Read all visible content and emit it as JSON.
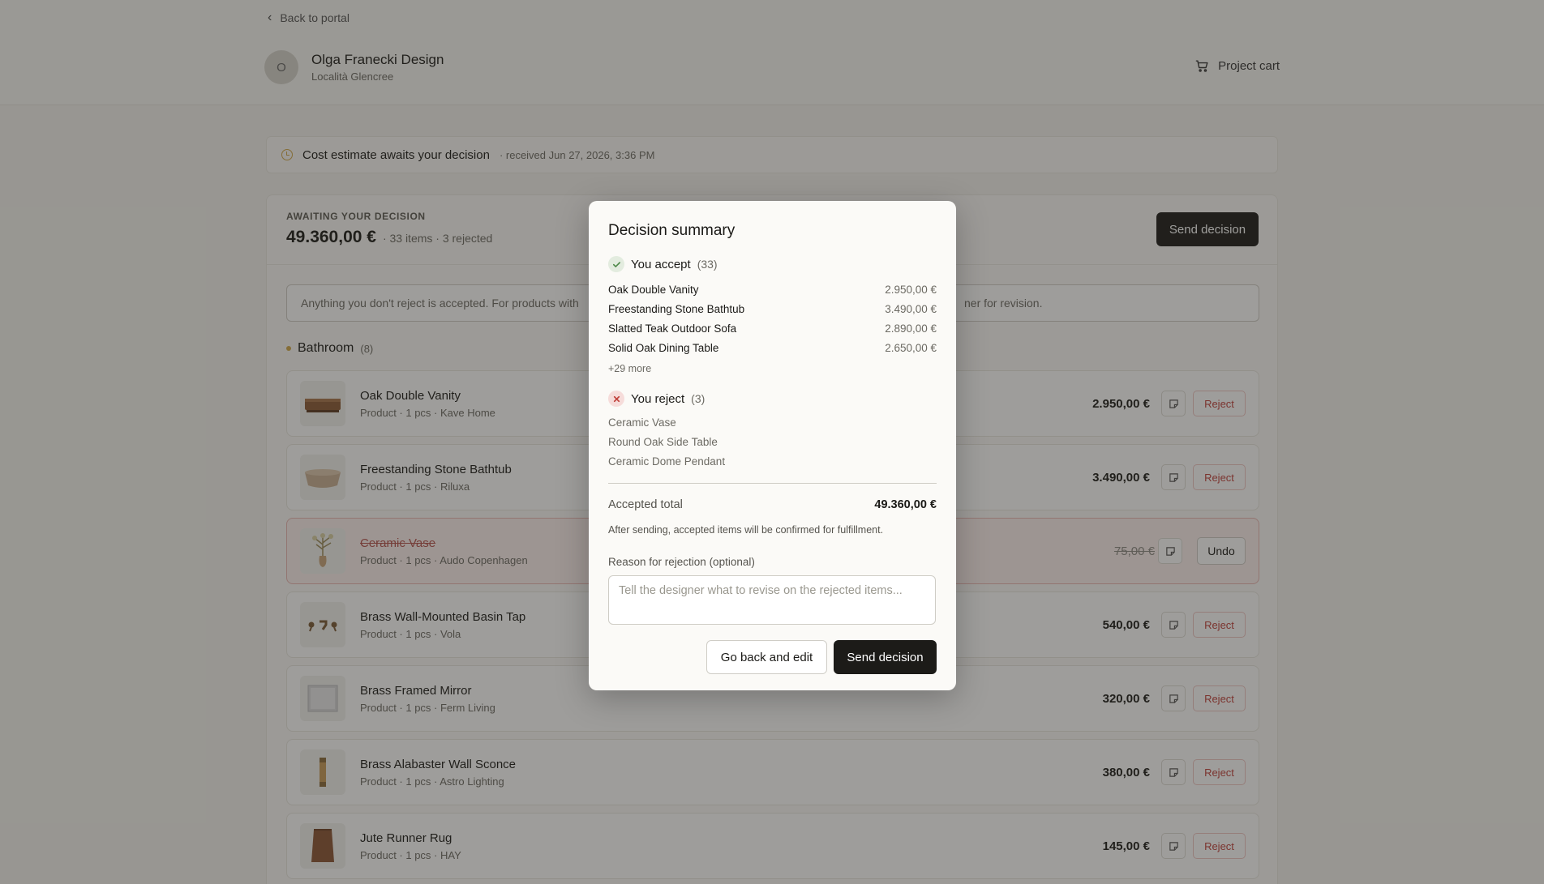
{
  "header": {
    "back_label": "Back to portal",
    "avatar_initial": "O",
    "studio_name": "Olga Franecki Design",
    "studio_location": "Località Glencree",
    "cart_label": "Project cart"
  },
  "notice": {
    "title": "Cost estimate awaits your decision",
    "meta": "· received Jun 27, 2026, 3:36 PM"
  },
  "summary_panel": {
    "eyebrow": "AWAITING YOUR DECISION",
    "total": "49.360,00 €",
    "meta": "· 33 items · 3 rejected",
    "send_label": "Send decision",
    "info_text": "Anything you don't reject is accepted. For products with",
    "info_tail": "ner for revision.",
    "section": {
      "name": "Bathroom",
      "count": "(8)"
    }
  },
  "items": [
    {
      "name": "Oak Double Vanity",
      "sub": "Product · 1 pcs · Kave Home",
      "price": "2.950,00 €",
      "action": "Reject",
      "rejected": false,
      "thumb": "vanity"
    },
    {
      "name": "Freestanding Stone Bathtub",
      "sub": "Product · 1 pcs · Riluxa",
      "price": "3.490,00 €",
      "action": "Reject",
      "rejected": false,
      "thumb": "bathtub"
    },
    {
      "name": "Ceramic Vase",
      "sub": "Product · 1 pcs · Audo Copenhagen",
      "price": "75,00 €",
      "action": "Undo",
      "rejected": true,
      "thumb": "vase"
    },
    {
      "name": "Brass Wall-Mounted Basin Tap",
      "sub": "Product · 1 pcs · Vola",
      "price": "540,00 €",
      "action": "Reject",
      "rejected": false,
      "thumb": "tap"
    },
    {
      "name": "Brass Framed Mirror",
      "sub": "Product · 1 pcs · Ferm Living",
      "price": "320,00 €",
      "action": "Reject",
      "rejected": false,
      "thumb": "mirror"
    },
    {
      "name": "Brass Alabaster Wall Sconce",
      "sub": "Product · 1 pcs · Astro Lighting",
      "price": "380,00 €",
      "action": "Reject",
      "rejected": false,
      "thumb": "sconce"
    },
    {
      "name": "Jute Runner Rug",
      "sub": "Product · 1 pcs · HAY",
      "price": "145,00 €",
      "action": "Reject",
      "rejected": false,
      "thumb": "rug"
    }
  ],
  "modal": {
    "title": "Decision summary",
    "accept_label": "You accept",
    "accept_count": "(33)",
    "accepted": [
      {
        "name": "Oak Double Vanity",
        "price": "2.950,00 €"
      },
      {
        "name": "Freestanding Stone Bathtub",
        "price": "3.490,00 €"
      },
      {
        "name": "Slatted Teak Outdoor Sofa",
        "price": "2.890,00 €"
      },
      {
        "name": "Solid Oak Dining Table",
        "price": "2.650,00 €"
      }
    ],
    "more": "+29 more",
    "reject_label": "You reject",
    "reject_count": "(3)",
    "rejected": [
      "Ceramic Vase",
      "Round Oak Side Table",
      "Ceramic Dome Pendant"
    ],
    "total_label": "Accepted total",
    "total_value": "49.360,00 €",
    "after_text": "After sending, accepted items will be confirmed for fulfillment.",
    "reason_label": "Reason for rejection (optional)",
    "reason_value": "",
    "reason_placeholder": "Tell the designer what to revise on the rejected items...",
    "back_label": "Go back and edit",
    "send_label": "Send decision"
  },
  "colors": {
    "accent_dark": "#1c1b18",
    "reject_red": "#c0413b",
    "pending_gold": "#d1a84a",
    "accept_green": "#4f8a4a"
  }
}
